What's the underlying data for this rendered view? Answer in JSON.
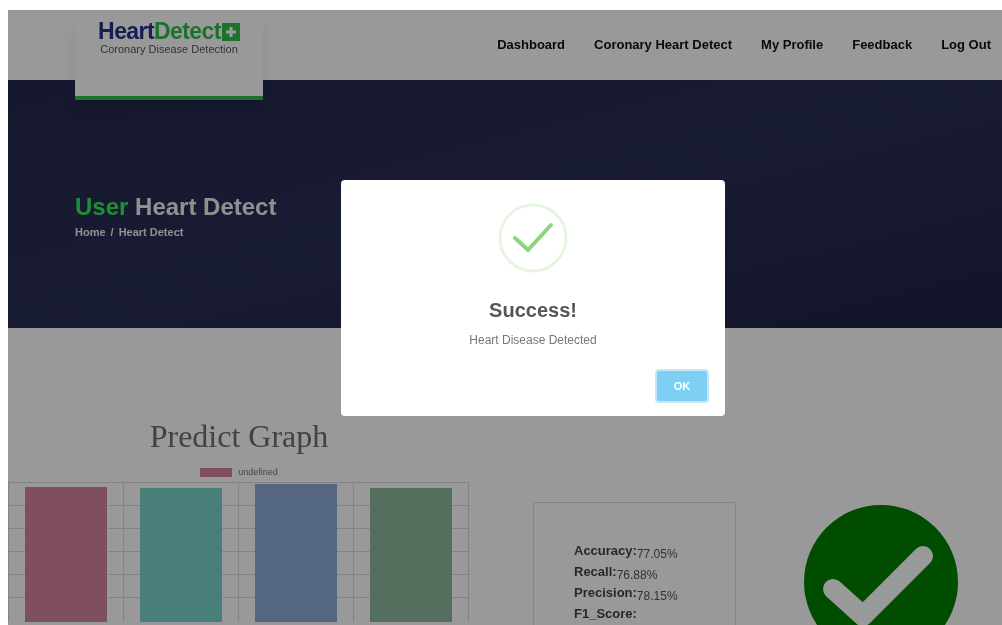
{
  "logo": {
    "name_part1": "Heart",
    "name_part2": "Detect",
    "tagline": "Coronary Disease Detection"
  },
  "nav": [
    {
      "label": "Dashboard"
    },
    {
      "label": "Coronary Heart Detect"
    },
    {
      "label": "My Profile"
    },
    {
      "label": "Feedback"
    },
    {
      "label": "Log Out"
    }
  ],
  "hero": {
    "title_highlight": "User",
    "title_rest": "Heart Detect",
    "breadcrumb": {
      "home": "Home",
      "separator": "/",
      "current": "Heart Detect"
    }
  },
  "graph": {
    "title": "Predict Graph",
    "legend": "undefined"
  },
  "metrics": [
    {
      "label": "Accuracy:",
      "value": "77.05%"
    },
    {
      "label": "Recall:",
      "value": "76.88%"
    },
    {
      "label": "Precision:",
      "value": "78.15%"
    },
    {
      "label": "F1_Score:"
    }
  ],
  "dialog": {
    "title": "Success!",
    "message": "Heart Disease Detected",
    "button": "OK"
  }
}
